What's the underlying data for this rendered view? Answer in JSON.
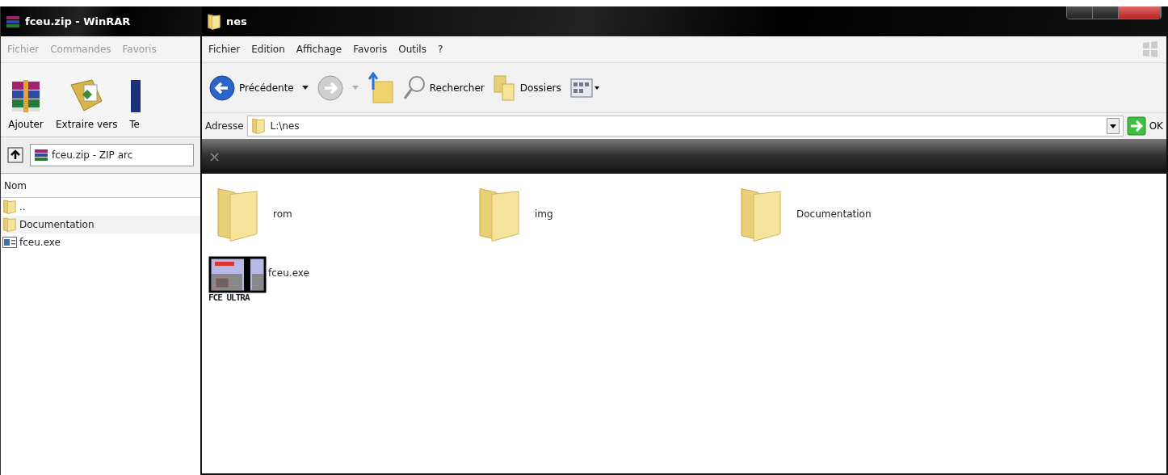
{
  "winrar": {
    "title": "fceu.zip - WinRAR",
    "menu": [
      "Fichier",
      "Commandes",
      "Favoris"
    ],
    "toolbar": [
      {
        "label": "Ajouter",
        "kind": "add"
      },
      {
        "label": "Extraire vers",
        "kind": "extract"
      },
      {
        "label": "Te",
        "kind": "test"
      }
    ],
    "path": "fceu.zip - ZIP arc",
    "columns": [
      "Nom"
    ],
    "rows": [
      {
        "name": "..",
        "kind": "folder"
      },
      {
        "name": "Documentation",
        "kind": "folder"
      },
      {
        "name": "fceu.exe",
        "kind": "exe"
      }
    ]
  },
  "explorer": {
    "title": "nes",
    "menu": [
      "Fichier",
      "Edition",
      "Affichage",
      "Favoris",
      "Outils",
      "?"
    ],
    "toolbar": [
      {
        "label": "Précédente",
        "kind": "back"
      },
      {
        "kind": "forward"
      },
      {
        "kind": "up"
      },
      {
        "label": "Rechercher",
        "kind": "search"
      },
      {
        "label": "Dossiers",
        "kind": "folders"
      },
      {
        "kind": "views"
      }
    ],
    "address_label": "Adresse",
    "address": "L:\\nes",
    "go_button": "OK",
    "close_glyph": "×",
    "items": [
      {
        "name": "rom",
        "kind": "folder"
      },
      {
        "name": "img",
        "kind": "folder"
      },
      {
        "name": "Documentation",
        "kind": "folder"
      },
      {
        "name": "fceu.exe",
        "kind": "exe",
        "logo_text": "FCE ULTRA"
      }
    ]
  }
}
